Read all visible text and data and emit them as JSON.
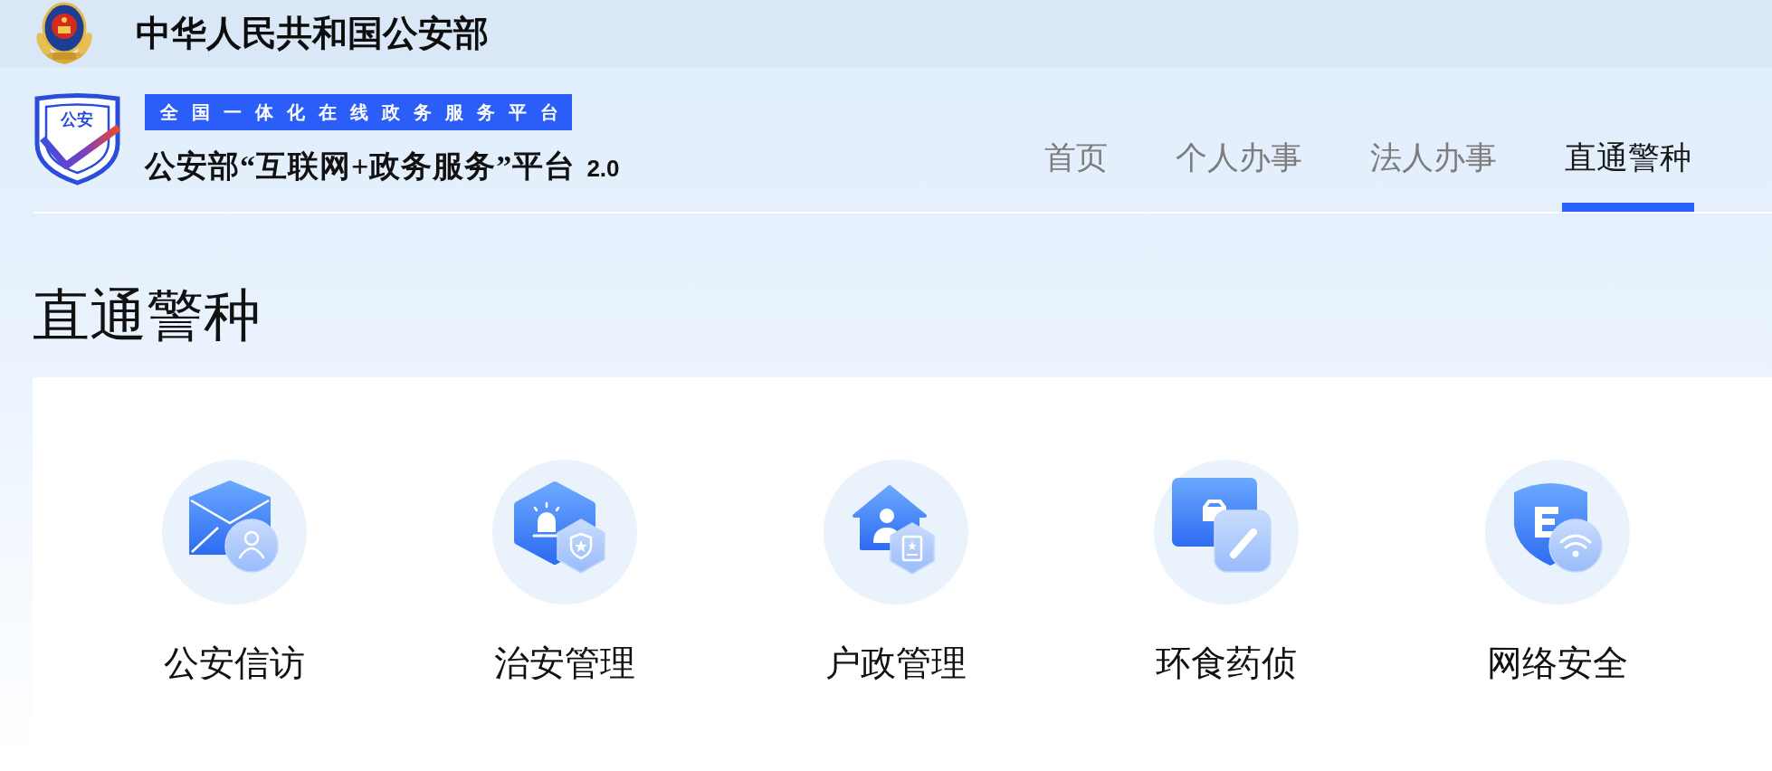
{
  "top_bar": {
    "title": "中华人民共和国公安部"
  },
  "header": {
    "logo_text": "公安",
    "banner": "全国一体化在线政务服务平台",
    "title": "公安部“互联网+政务服务”平台",
    "version": "2.0"
  },
  "nav": {
    "tabs": [
      {
        "label": "首页",
        "selected": false
      },
      {
        "label": "个人办事",
        "selected": false
      },
      {
        "label": "法人办事",
        "selected": false
      },
      {
        "label": "直通警种",
        "selected": true
      }
    ]
  },
  "section": {
    "title": "直通警种",
    "services": [
      {
        "label": "公安信访"
      },
      {
        "label": "治安管理"
      },
      {
        "label": "户政管理"
      },
      {
        "label": "环食药侦"
      },
      {
        "label": "网络安全"
      }
    ]
  }
}
